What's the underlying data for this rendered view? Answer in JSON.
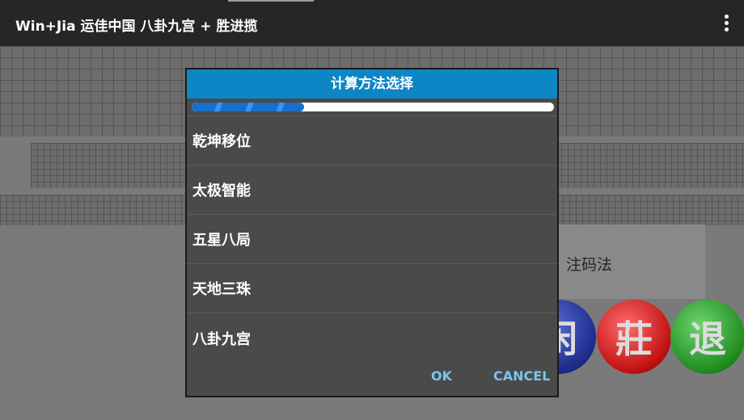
{
  "appbar": {
    "title": "Win+Jia 运佳中国 八卦九宫 + 胜进揽",
    "menu_icon": "overflow-menu-icon"
  },
  "background": {
    "bet_label": "注码法",
    "circle_buttons": [
      "闲",
      "莊",
      "退"
    ]
  },
  "dialog": {
    "title": "计算方法选择",
    "progress": 0.31,
    "colors": {
      "title_bg": "#0d86c5",
      "progress": "#1a6fc9",
      "button_text": "#7cc3f0"
    },
    "items": [
      {
        "label": "乾坤移位"
      },
      {
        "label": "太极智能"
      },
      {
        "label": "五星八局"
      },
      {
        "label": "天地三珠"
      },
      {
        "label": "八卦九宫"
      }
    ],
    "ok_label": "OK",
    "cancel_label": "CANCEL"
  }
}
